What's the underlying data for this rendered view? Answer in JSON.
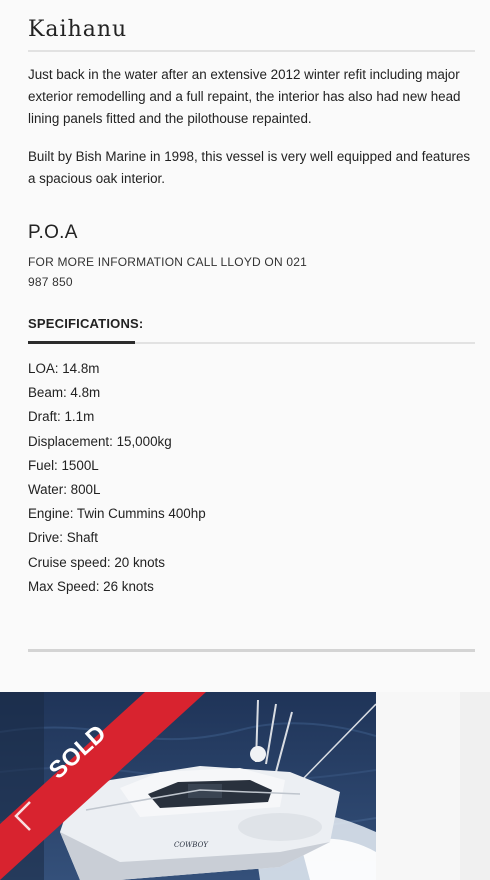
{
  "listing": {
    "title": "Kaihanu",
    "description": [
      "Just back in the water after an extensive 2012 winter refit including major exterior remodelling and a full repaint, the interior has also had new head lining panels fitted and the pilothouse repainted.",
      "Built by Bish Marine in 1998, this vessel is very well equipped and features a spacious oak interior."
    ],
    "price": "P.O.A",
    "contact": "FOR MORE INFORMATION CALL LLOYD ON 021 987 850"
  },
  "specifications": {
    "heading": "SPECIFICATIONS:",
    "items": [
      "LOA: 14.8m",
      "Beam: 4.8m",
      "Draft: 1.1m",
      "Displacement: 15,000kg",
      "Fuel: 1500L",
      "Water: 800L",
      "Engine: Twin Cummins 400hp",
      "Drive: Shaft",
      "Cruise speed: 20 knots",
      "Max Speed: 26 knots"
    ]
  },
  "gallery": {
    "badge": "SOLD",
    "badge_color": "#d8232f",
    "hull_text": "COWBOY",
    "prev_icon": "chevron-left-icon"
  }
}
